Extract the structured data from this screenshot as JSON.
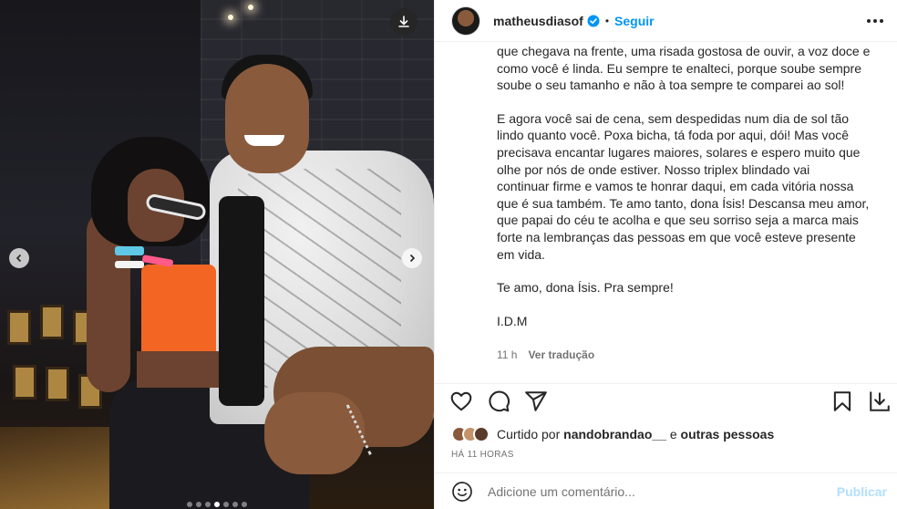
{
  "post": {
    "username": "matheusdiasof",
    "separator": "•",
    "follow_label": "Seguir",
    "caption": {
      "p1_l1": "que chegava na frente, uma risada gostosa de ouvir, a voz doce e",
      "p1_l2": "como você é linda. Eu sempre te enalteci, porque soube sempre",
      "p1_l3": "soube o seu tamanho e não à toa sempre te comparei ao sol!",
      "p2_l1": "E agora você sai de cena, sem despedidas num dia de sol tão",
      "p2_l2": "lindo quanto você. Poxa bicha, tá foda por aqui, dói! Mas você",
      "p2_l3": "precisava encantar lugares maiores, solares e espero muito que",
      "p2_l4": "olhe por nós de onde estiver. Nosso triplex blindado vai",
      "p2_l5": "continuar firme e vamos te honrar daqui, em cada vitória nossa",
      "p2_l6": "que é sua também. Te amo tanto, dona Ísis! Descansa meu amor,",
      "p2_l7": "que papai do céu te acolha e que seu sorriso seja a marca mais",
      "p2_l8": "forte na lembranças das pessoas em que você esteve presente",
      "p2_l9": "em vida.",
      "p3": "Te amo, dona Ísis. Pra sempre!",
      "p4": "I.D.M"
    },
    "age": "11 h",
    "translate_label": "Ver tradução",
    "likes": {
      "prefix": "Curtido por",
      "user": "nandobrandao__",
      "middle": "e",
      "suffix": "outras pessoas"
    },
    "timestamp": "HÁ 11 HORAS",
    "comment_placeholder": "Adicione um comentário...",
    "publish_label": "Publicar"
  },
  "carousel": {
    "total": 7,
    "active_index": 3
  },
  "colors": {
    "link_blue": "#0095f6",
    "publish_disabled": "#b2dffc",
    "muted_text": "#737373",
    "border": "#efefef"
  },
  "icons": {
    "header": [
      "verified-badge-icon",
      "more-options-icon"
    ],
    "actions": [
      "heart-icon",
      "comment-icon",
      "share-icon",
      "bookmark-icon",
      "save-download-icon"
    ],
    "photo": [
      "download-icon",
      "chevron-left-icon",
      "chevron-right-icon"
    ],
    "comment": [
      "emoji-icon"
    ]
  }
}
